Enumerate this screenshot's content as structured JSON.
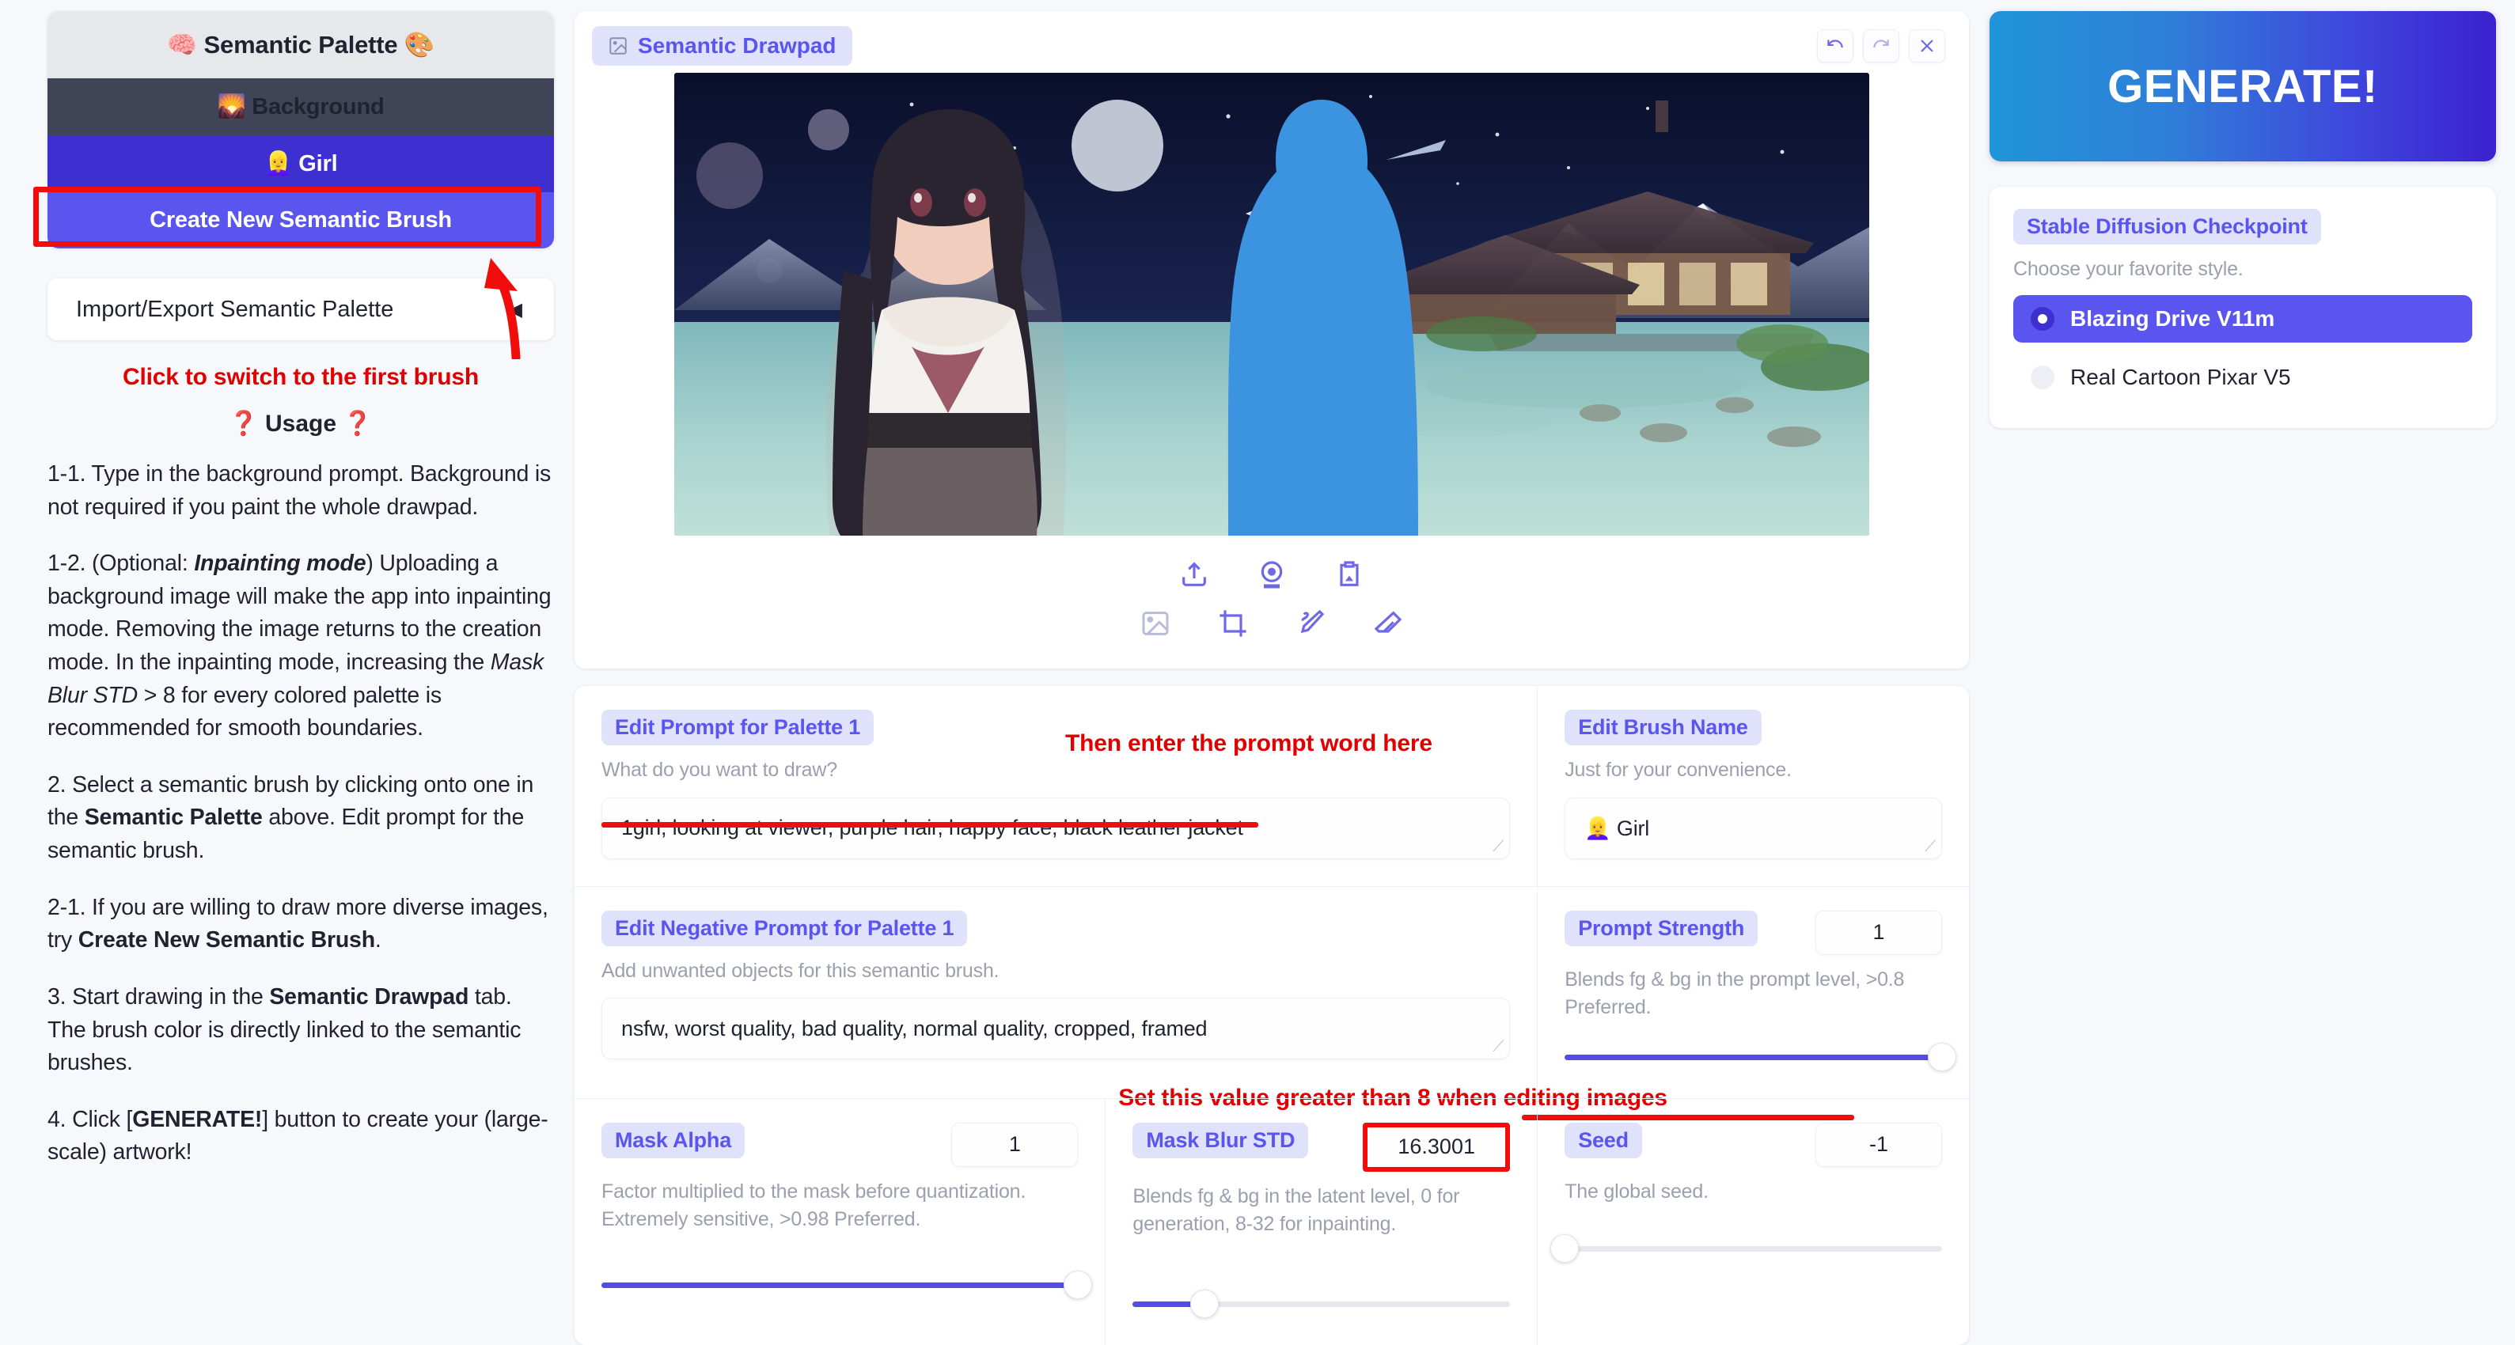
{
  "sidebar": {
    "palette_title": "🧠 Semantic Palette 🎨",
    "brushes": [
      {
        "label": "🌄 Background",
        "icon": "sunrise-icon"
      },
      {
        "label": "👱‍♀️ Girl",
        "icon": "girl-icon"
      }
    ],
    "create_brush_label": "Create New Semantic Brush",
    "accordion": {
      "label": "Import/Export Semantic Palette",
      "caret": "◀"
    },
    "annotation_switch": "Click to switch to the first brush",
    "usage_heading_q": "❓",
    "usage_heading": "Usage",
    "usage": [
      "1-1. Type in the background prompt. Background is not required if you paint the whole drawpad.",
      "1-2. (Optional: Inpainting mode) Uploading a background image will make the app into inpainting mode. Removing the image returns to the creation mode. In the inpainting mode, increasing the Mask Blur STD > 8 for every colored palette is recommended for smooth boundaries.",
      "2. Select a semantic brush by clicking onto one in the Semantic Palette above. Edit prompt for the semantic brush.",
      "2-1. If you are willing to draw more diverse images, try Create New Semantic Brush.",
      "3. Start drawing in the Semantic Drawpad tab. The brush color is directly linked to the semantic brushes.",
      "4. Click [GENERATE!] button to create your (large-scale) artwork!"
    ]
  },
  "drawpad": {
    "tab_label": "Semantic Drawpad",
    "tab_icon": "image-icon",
    "actions": [
      {
        "name": "undo-button",
        "icon": "undo-icon"
      },
      {
        "name": "redo-button",
        "icon": "redo-icon"
      },
      {
        "name": "close-button",
        "icon": "close-icon"
      }
    ],
    "toolbar_top": [
      {
        "name": "upload-button",
        "icon": "upload-icon"
      },
      {
        "name": "webcam-button",
        "icon": "webcam-icon"
      },
      {
        "name": "paste-button",
        "icon": "clipboard-image-icon"
      }
    ],
    "toolbar_bottom": [
      {
        "name": "image-tool-button",
        "icon": "image-icon"
      },
      {
        "name": "crop-tool-button",
        "icon": "crop-icon"
      },
      {
        "name": "brush-tool-button",
        "icon": "brush-icon"
      },
      {
        "name": "eraser-tool-button",
        "icon": "eraser-icon"
      }
    ]
  },
  "params": {
    "prompt": {
      "chip": "Edit Prompt for Palette 1",
      "hint": "What do you want to draw?",
      "value": "1girl, looking at viewer, purple hair, happy face, black leather jacket",
      "annotation": "Then enter the prompt word here"
    },
    "negative_prompt": {
      "chip": "Edit Negative Prompt for Palette 1",
      "hint": "Add unwanted objects for this semantic brush.",
      "value": "nsfw, worst quality, bad quality, normal quality, cropped, framed"
    },
    "brush_name": {
      "chip": "Edit Brush Name",
      "hint": "Just for your convenience.",
      "value": "👱‍♀️ Girl"
    },
    "prompt_strength": {
      "chip": "Prompt Strength",
      "hint": "Blends fg & bg in the prompt level, >0.8 Preferred.",
      "value": "1",
      "slider_pct": 100,
      "annotation": "Set this value greater than 8 when editing images"
    },
    "mask_alpha": {
      "chip": "Mask Alpha",
      "hint": "Factor multiplied to the mask before quantization. Extremely sensitive, >0.98 Preferred.",
      "value": "1",
      "slider_pct": 100
    },
    "mask_blur_std": {
      "chip": "Mask Blur STD",
      "hint": "Blends fg & bg in the latent level, 0 for generation, 8-32 for inpainting.",
      "value": "16.3001",
      "slider_pct": 19
    },
    "seed": {
      "chip": "Seed",
      "hint": "The global seed.",
      "value": "-1",
      "slider_pct": 0
    }
  },
  "right": {
    "generate_label": "GENERATE!",
    "checkpoint": {
      "chip": "Stable Diffusion Checkpoint",
      "hint": "Choose your favorite style.",
      "options": [
        {
          "label": "Blazing Drive V11m",
          "selected": true
        },
        {
          "label": "Real Cartoon Pixar V5",
          "selected": false
        }
      ]
    }
  },
  "colors": {
    "accent": "#5b55f0",
    "brush_girl": "#3d2fd0",
    "annotation_red": "#e00000",
    "mask_blue": "#3c93e0"
  }
}
